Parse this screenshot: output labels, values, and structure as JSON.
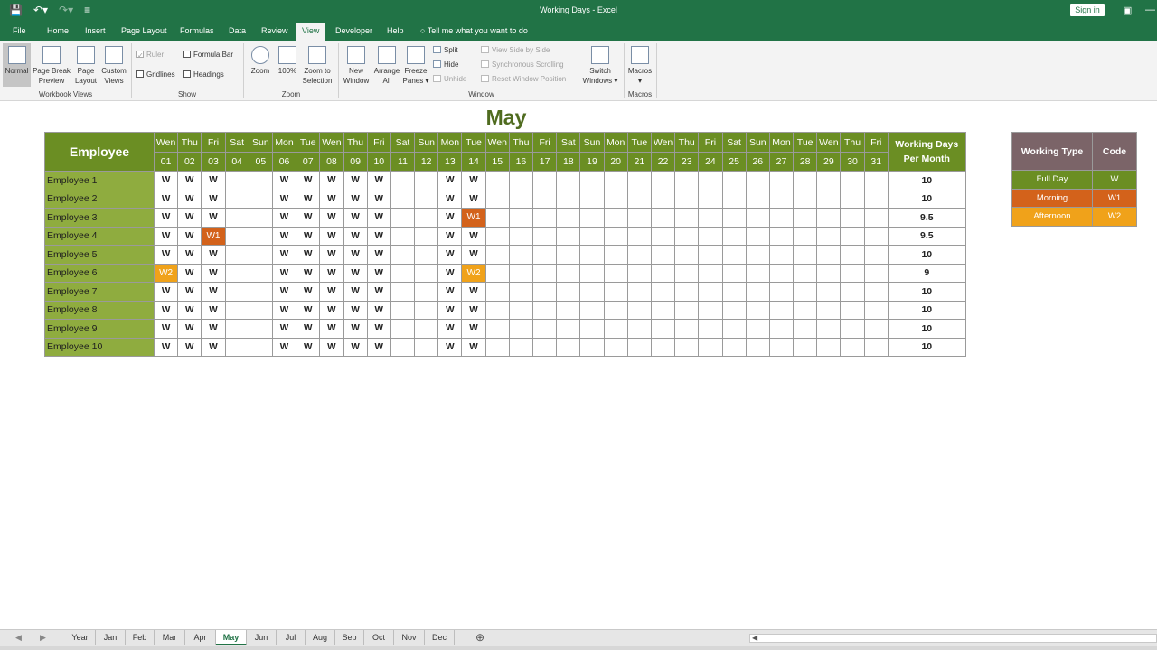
{
  "window": {
    "title": "Working Days  -  Excel",
    "signin": "Sign in"
  },
  "menu": [
    "File",
    "Home",
    "Insert",
    "Page Layout",
    "Formulas",
    "Data",
    "Review",
    "View",
    "Developer",
    "Help"
  ],
  "menu_active": "View",
  "tellme": "Tell me what you want to do",
  "ribbon": {
    "workbook_views": {
      "label": "Workbook Views",
      "normal": "Normal",
      "page_break_1": "Page Break",
      "page_break_2": "Preview",
      "page_layout_1": "Page",
      "page_layout_2": "Layout",
      "custom_1": "Custom",
      "custom_2": "Views"
    },
    "show": {
      "label": "Show",
      "ruler": "Ruler",
      "formula_bar": "Formula Bar",
      "gridlines": "Gridlines",
      "headings": "Headings"
    },
    "zoom": {
      "label": "Zoom",
      "zoom": "Zoom",
      "hundred": "100%",
      "sel_1": "Zoom to",
      "sel_2": "Selection"
    },
    "window": {
      "label": "Window",
      "new_1": "New",
      "new_2": "Window",
      "arrange_1": "Arrange",
      "arrange_2": "All",
      "freeze_1": "Freeze",
      "freeze_2": "Panes",
      "split": "Split",
      "hide": "Hide",
      "unhide": "Unhide",
      "side": "View Side by Side",
      "sync": "Synchronous Scrolling",
      "reset": "Reset Window Position",
      "switch_1": "Switch",
      "switch_2": "Windows"
    },
    "macros": {
      "label": "Macros",
      "macros": "Macros"
    }
  },
  "sheet": {
    "month_title": "May",
    "employee_header": "Employee",
    "working_days_header_1": "Working Days",
    "working_days_header_2": "Per Month",
    "weekdays": [
      "Wen",
      "Thu",
      "Fri",
      "Sat",
      "Sun",
      "Mon",
      "Tue",
      "Wen",
      "Thu",
      "Fri",
      "Sat",
      "Sun",
      "Mon",
      "Tue",
      "Wen",
      "Thu",
      "Fri",
      "Sat",
      "Sun",
      "Mon",
      "Tue",
      "Wen",
      "Thu",
      "Fri",
      "Sat",
      "Sun",
      "Mon",
      "Tue",
      "Wen",
      "Thu",
      "Fri"
    ],
    "dates": [
      "01",
      "02",
      "03",
      "04",
      "05",
      "06",
      "07",
      "08",
      "09",
      "10",
      "11",
      "12",
      "13",
      "14",
      "15",
      "16",
      "17",
      "18",
      "19",
      "20",
      "21",
      "22",
      "23",
      "24",
      "25",
      "26",
      "27",
      "28",
      "29",
      "30",
      "31"
    ],
    "rows": [
      {
        "name": "Employee 1",
        "cells": {
          "01": "W",
          "02": "W",
          "03": "W",
          "06": "W",
          "07": "W",
          "08": "W",
          "09": "W",
          "10": "W",
          "13": "W",
          "14": "W"
        },
        "total": "10"
      },
      {
        "name": "Employee 2",
        "cells": {
          "01": "W",
          "02": "W",
          "03": "W",
          "06": "W",
          "07": "W",
          "08": "W",
          "09": "W",
          "10": "W",
          "13": "W",
          "14": "W"
        },
        "total": "10"
      },
      {
        "name": "Employee 3",
        "cells": {
          "01": "W",
          "02": "W",
          "03": "W",
          "06": "W",
          "07": "W",
          "08": "W",
          "09": "W",
          "10": "W",
          "13": "W",
          "14": "W1"
        },
        "total": "9.5"
      },
      {
        "name": "Employee 4",
        "cells": {
          "01": "W",
          "02": "W",
          "03": "W1",
          "06": "W",
          "07": "W",
          "08": "W",
          "09": "W",
          "10": "W",
          "13": "W",
          "14": "W"
        },
        "total": "9.5"
      },
      {
        "name": "Employee 5",
        "cells": {
          "01": "W",
          "02": "W",
          "03": "W",
          "06": "W",
          "07": "W",
          "08": "W",
          "09": "W",
          "10": "W",
          "13": "W",
          "14": "W"
        },
        "total": "10"
      },
      {
        "name": "Employee 6",
        "cells": {
          "01": "W2",
          "02": "W",
          "03": "W",
          "06": "W",
          "07": "W",
          "08": "W",
          "09": "W",
          "10": "W",
          "13": "W",
          "14": "W2"
        },
        "total": "9"
      },
      {
        "name": "Employee 7",
        "cells": {
          "01": "W",
          "02": "W",
          "03": "W",
          "06": "W",
          "07": "W",
          "08": "W",
          "09": "W",
          "10": "W",
          "13": "W",
          "14": "W"
        },
        "total": "10"
      },
      {
        "name": "Employee 8",
        "cells": {
          "01": "W",
          "02": "W",
          "03": "W",
          "06": "W",
          "07": "W",
          "08": "W",
          "09": "W",
          "10": "W",
          "13": "W",
          "14": "W"
        },
        "total": "10"
      },
      {
        "name": "Employee 9",
        "cells": {
          "01": "W",
          "02": "W",
          "03": "W",
          "06": "W",
          "07": "W",
          "08": "W",
          "09": "W",
          "10": "W",
          "13": "W",
          "14": "W"
        },
        "total": "10"
      },
      {
        "name": "Employee 10",
        "cells": {
          "01": "W",
          "02": "W",
          "03": "W",
          "06": "W",
          "07": "W",
          "08": "W",
          "09": "W",
          "10": "W",
          "13": "W",
          "14": "W"
        },
        "total": "10"
      }
    ]
  },
  "legend": {
    "header_type": "Working Type",
    "header_code": "Code",
    "items": [
      {
        "type": "Full Day",
        "code": "W",
        "color": "#6b8e23"
      },
      {
        "type": "Morning",
        "code": "W1",
        "color": "#d3621b"
      },
      {
        "type": "Afternoon",
        "code": "W2",
        "color": "#f0a21a"
      }
    ]
  },
  "tabs": [
    "Year",
    "Jan",
    "Feb",
    "Mar",
    "Apr",
    "May",
    "Jun",
    "Jul",
    "Aug",
    "Sep",
    "Oct",
    "Nov",
    "Dec"
  ],
  "active_tab": "May"
}
